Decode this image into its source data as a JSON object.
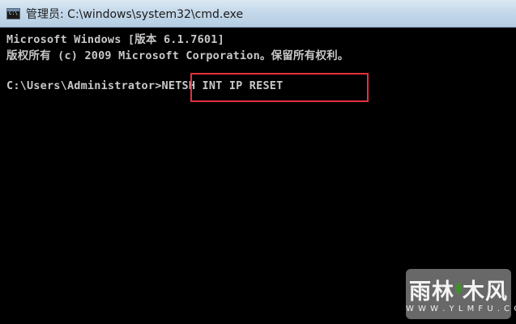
{
  "window": {
    "title": "管理员: C:\\windows\\system32\\cmd.exe",
    "icon": "console-icon"
  },
  "console": {
    "lines": [
      "Microsoft Windows [版本 6.1.7601]",
      "版权所有 (c) 2009 Microsoft Corporation。保留所有权利。",
      "C:\\Users\\Administrator>NETSH INT IP RESET"
    ],
    "text_color": "#c8c8c8",
    "background": "#000000"
  },
  "annotation": {
    "highlight_color": "#e5303e"
  },
  "watermark": {
    "brand_text": "雨林木风",
    "url_text": "W W W . Y L M F U . C O M"
  }
}
